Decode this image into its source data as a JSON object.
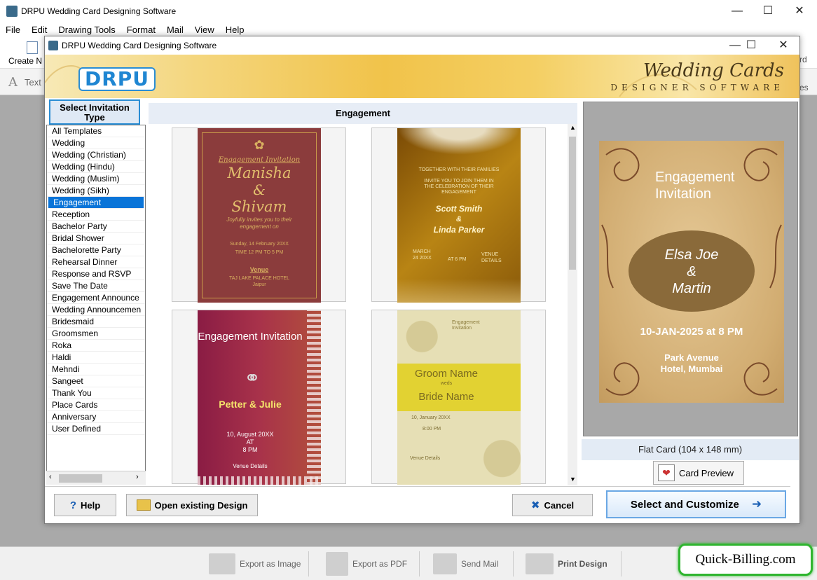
{
  "app": {
    "title": "DRPU Wedding Card Designing Software",
    "menu": [
      "File",
      "Edit",
      "Drawing Tools",
      "Format",
      "Mail",
      "View",
      "Help"
    ],
    "toolbar": {
      "create_label": "Create N",
      "text_label": "Text",
      "right_partial_1": "rd",
      "right_partial_2": "es"
    }
  },
  "dialog": {
    "title": "DRPU Wedding Card Designing Software",
    "logo_text": "DRPU",
    "banner_title": "Wedding Cards",
    "banner_subtitle": "DESIGNER SOFTWARE",
    "select_type_header": "Select Invitation Type",
    "types": [
      "All Templates",
      "Wedding",
      "Wedding (Christian)",
      "Wedding (Hindu)",
      "Wedding (Muslim)",
      "Wedding (Sikh)",
      "Engagement",
      "Reception",
      "Bachelor Party",
      "Bridal Shower",
      "Bachelorette Party",
      "Rehearsal Dinner",
      "Response and RSVP",
      "Save The Date",
      "Engagement Announce",
      "Wedding Announcemen",
      "Bridesmaid",
      "Groomsmen",
      "Roka",
      "Haldi",
      "Mehndi",
      "Sangeet",
      "Thank You",
      "Place Cards",
      "Anniversary",
      "User Defined"
    ],
    "selected_type": "Engagement",
    "category_header": "Engagement",
    "templates": {
      "t1": {
        "heading": "Engagement Invitation",
        "name1": "Manisha",
        "amp": "&",
        "name2": "Shivam",
        "invite": "Joyfully invites you to their engagement on",
        "date": "Sunday, 14 February 20XX",
        "time": "TIME 12 PM TO 5 PM",
        "venue_label": "Venue",
        "venue": "TAJ LAKE PALACE HOTEL",
        "city": "Jaipur"
      },
      "t2": {
        "line1": "TOGETHER WITH THEIR FAMILIES",
        "line2": "INVITE YOU TO JOIN THEM IN THE CELEBRATION OF THEIR ENGAGEMENT",
        "name1": "Scott Smith",
        "amp": "&",
        "name2": "Linda Parker",
        "date": "MARCH 24 20XX",
        "time": "AT 6 PM",
        "venue": "VENUE DETAILS"
      },
      "t3": {
        "heading": "Engagement Invitation",
        "names": "Petter & Julie",
        "date": "10, August 20XX",
        "at": "AT",
        "time": "8 PM",
        "venue": "Venue Details"
      },
      "t4": {
        "heading": "Engagement Invitation",
        "groom": "Groom Name",
        "weds": "weds",
        "bride": "Bride Name",
        "date": "10, January 20XX",
        "time": "8:00 PM",
        "venue": "Venue Details"
      }
    },
    "preview": {
      "heading": "Engagement Invitation",
      "name1": "Elsa Joe",
      "amp": "&",
      "name2": "Martin",
      "datetime": "10-JAN-2025 at 8 PM",
      "venue1": "Park Avenue",
      "venue2": "Hotel, Mumbai"
    },
    "card_size": "Flat Card (104 x 148 mm)",
    "card_preview_label": "Card Preview",
    "buttons": {
      "help": "Help",
      "open": "Open existing Design",
      "cancel": "Cancel",
      "select": "Select and Customize"
    }
  },
  "bottombar": {
    "export_image": "Export as Image",
    "export_pdf": "Export as PDF",
    "send_mail": "Send Mail",
    "print": "Print Design"
  },
  "brand": "Quick-Billing.com"
}
